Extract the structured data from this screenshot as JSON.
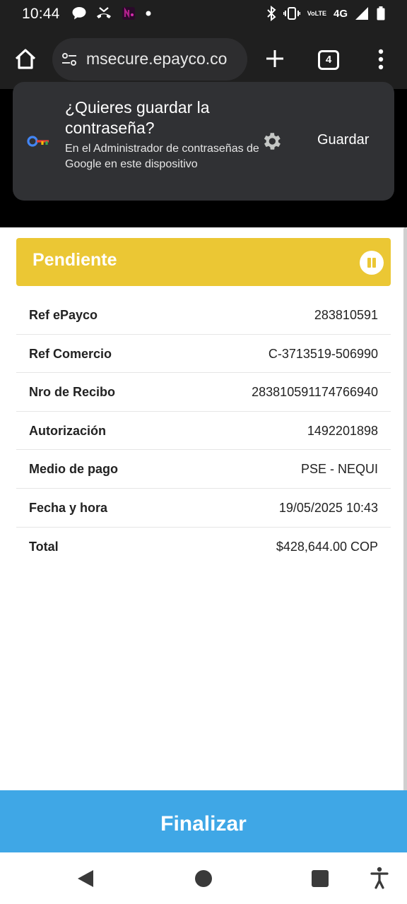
{
  "status_bar": {
    "time": "10:44",
    "network": "4G",
    "volte_top": "Vo",
    "volte_bottom": "LTE",
    "icons": [
      "chat-icon",
      "missed-call-icon",
      "app-icon",
      "dot-icon",
      "bluetooth-icon",
      "vibrate-icon",
      "volte-icon",
      "signal-icon",
      "battery-icon"
    ]
  },
  "browser": {
    "url": "msecure.epayco.co",
    "tab_count": "4"
  },
  "password_prompt": {
    "title": "¿Quieres guardar la contraseña?",
    "description": "En el Administrador de contraseñas de Google en este dispositivo",
    "save_label": "Guardar"
  },
  "transaction": {
    "status": "Pendiente",
    "status_color": "#ebc734",
    "rows": [
      {
        "label": "Ref ePayco",
        "value": "283810591"
      },
      {
        "label": "Ref Comercio",
        "value": "C-3713519-506990"
      },
      {
        "label": "Nro de Recibo",
        "value": "283810591174766940"
      },
      {
        "label": "Autorización",
        "value": "1492201898"
      },
      {
        "label": "Medio de pago",
        "value": "PSE - NEQUI"
      },
      {
        "label": "Fecha y hora",
        "value": "19/05/2025 10:43"
      },
      {
        "label": "Total",
        "value": "$428,644.00 COP"
      }
    ]
  },
  "finish_button": {
    "label": "Finalizar",
    "color": "#3fa7e6"
  }
}
